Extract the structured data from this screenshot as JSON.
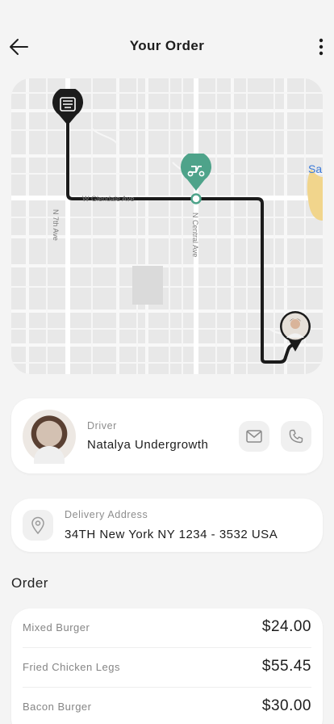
{
  "header": {
    "title": "Your Order",
    "back_icon": "arrow-left-icon",
    "menu_icon": "more-vertical-icon"
  },
  "map": {
    "streets": [
      "W Glendale Ave",
      "N 7th Ave",
      "N Central Ave"
    ],
    "place_label": "Sa",
    "route_color": "#1b1b1b",
    "courier_color": "#4ea38a",
    "restaurant_icon": "restaurant-pin-icon",
    "courier_icon": "scooter-pin-icon",
    "customer_icon": "customer-avatar-pin"
  },
  "driver": {
    "caption": "Driver",
    "name": "Natalya Undergrowth",
    "message_icon": "mail-icon",
    "call_icon": "phone-icon"
  },
  "delivery": {
    "caption": "Delivery Address",
    "address": "34TH New York NY 1234 - 3532 USA",
    "icon": "location-pin-icon"
  },
  "order": {
    "title": "Order",
    "items": [
      {
        "name": "Mixed Burger",
        "price": "$24.00"
      },
      {
        "name": "Fried Chicken Legs",
        "price": "$55.45"
      },
      {
        "name": "Bacon Burger",
        "price": "$30.00"
      }
    ]
  },
  "colors": {
    "background": "#f4f4f4",
    "card": "#ffffff",
    "accent": "#4ea38a",
    "text": "#1d1d1d",
    "muted": "#8d8d8d"
  }
}
